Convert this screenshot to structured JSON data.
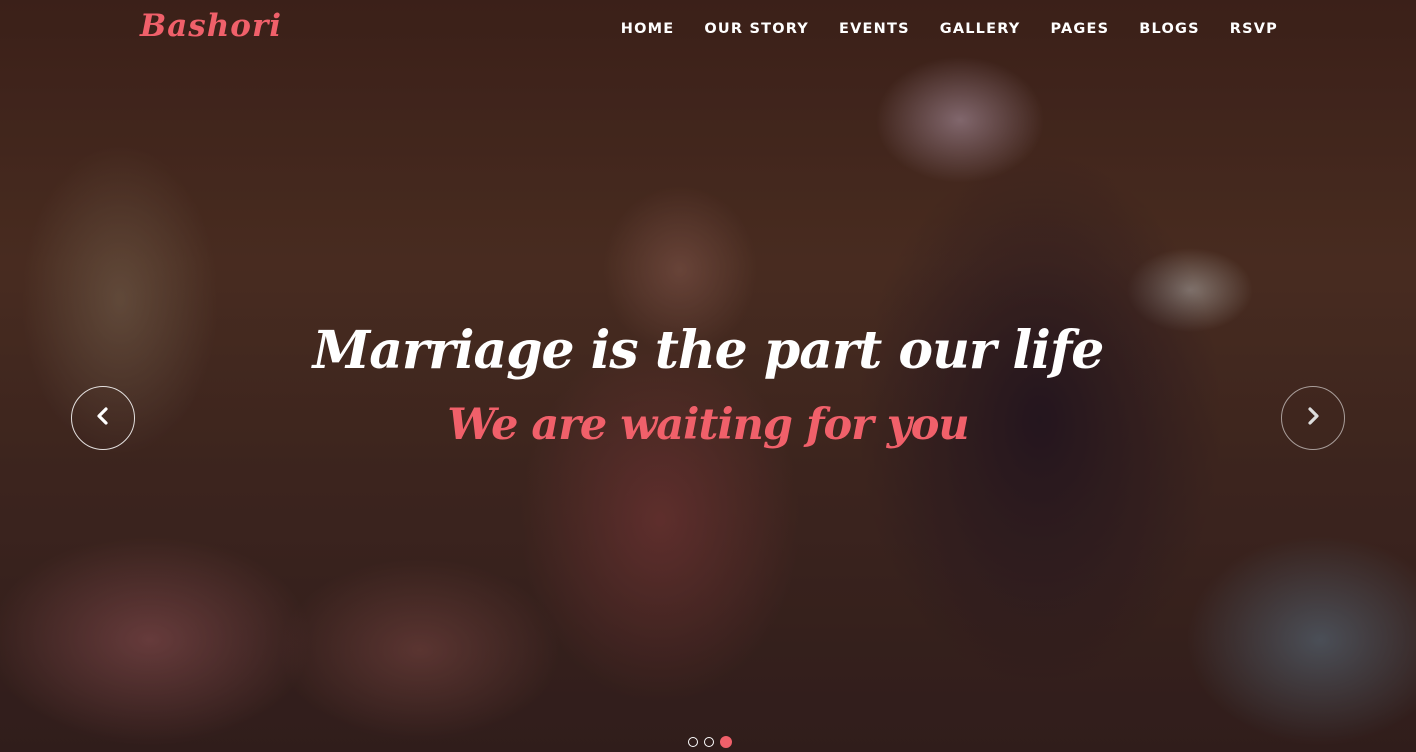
{
  "brand": {
    "name": "Bashori",
    "accent_color": "#f0606a"
  },
  "nav": {
    "items": [
      {
        "label": "HOME"
      },
      {
        "label": "OUR STORY"
      },
      {
        "label": "EVENTS"
      },
      {
        "label": "GALLERY"
      },
      {
        "label": "PAGES"
      },
      {
        "label": "BLOGS"
      },
      {
        "label": "RSVP"
      }
    ]
  },
  "slider": {
    "headline": "Marriage is the part our life",
    "subheadline": "We are waiting for you",
    "prev_icon": "chevron-left-icon",
    "next_icon": "chevron-right-icon",
    "slide_count": 3,
    "active_slide": 3
  }
}
